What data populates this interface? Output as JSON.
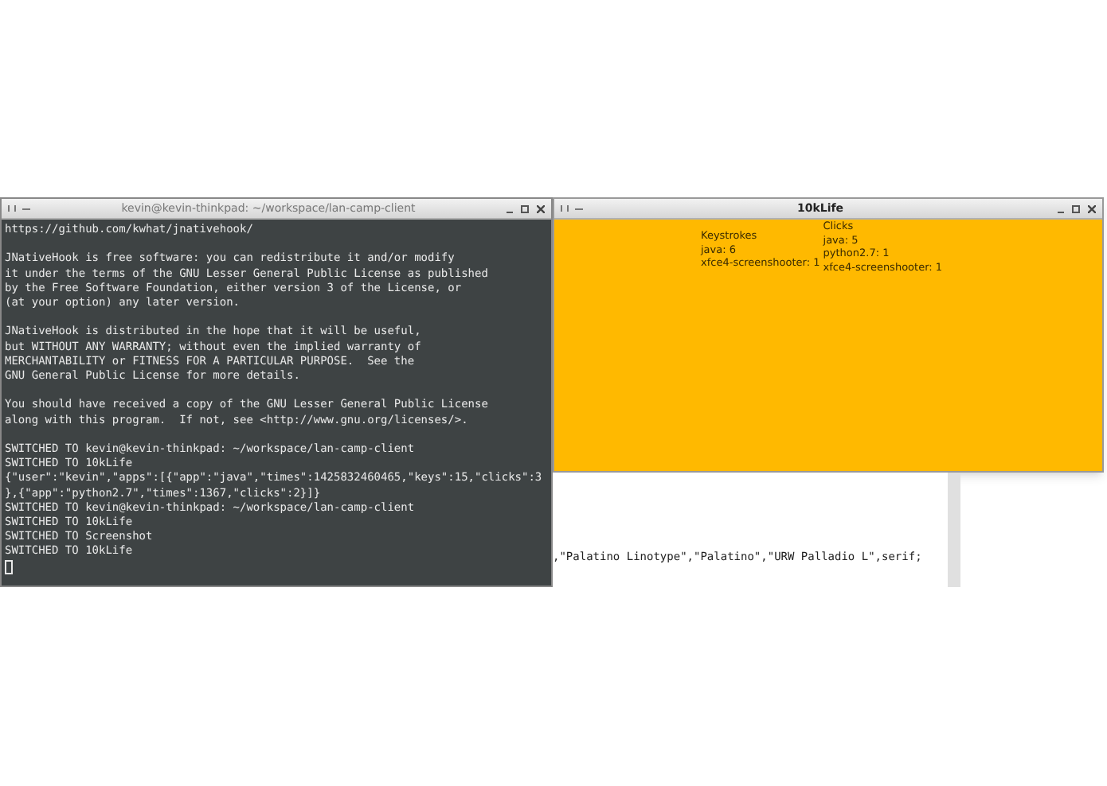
{
  "terminal": {
    "title": "kevin@kevin-thinkpad: ~/workspace/lan-camp-client",
    "blocks": [
      [
        "https://github.com/kwhat/jnativehook/"
      ],
      [
        "JNativeHook is free software: you can redistribute it and/or modify",
        "it under the terms of the GNU Lesser General Public License as published",
        "by the Free Software Foundation, either version 3 of the License, or",
        "(at your option) any later version."
      ],
      [
        "JNativeHook is distributed in the hope that it will be useful,",
        "but WITHOUT ANY WARRANTY; without even the implied warranty of",
        "MERCHANTABILITY or FITNESS FOR A PARTICULAR PURPOSE.  See the",
        "GNU General Public License for more details."
      ],
      [
        "You should have received a copy of the GNU Lesser General Public License",
        "along with this program.  If not, see <http://www.gnu.org/licenses/>."
      ],
      [
        "SWITCHED TO kevin@kevin-thinkpad: ~/workspace/lan-camp-client",
        "SWITCHED TO 10kLife",
        "{\"user\":\"kevin\",\"apps\":[{\"app\":\"java\",\"times\":1425832460465,\"keys\":15,\"clicks\":3",
        "},{\"app\":\"python2.7\",\"times\":1367,\"clicks\":2}]}",
        "SWITCHED TO kevin@kevin-thinkpad: ~/workspace/lan-camp-client",
        "SWITCHED TO 10kLife",
        "SWITCHED TO Screenshot",
        "SWITCHED TO 10kLife"
      ]
    ]
  },
  "app_window": {
    "title": "10kLife",
    "columns": [
      {
        "heading": "Keystrokes",
        "entries": [
          "java: 6",
          "xfce4-screenshooter: 1"
        ]
      },
      {
        "heading": "Clicks",
        "entries": [
          "java: 5",
          "python2.7: 1",
          "xfce4-screenshooter: 1"
        ]
      }
    ]
  },
  "editor": {
    "code_line": ",\"Palatino Linotype\",\"Palatino\",\"URW Palladio L\",serif;"
  }
}
